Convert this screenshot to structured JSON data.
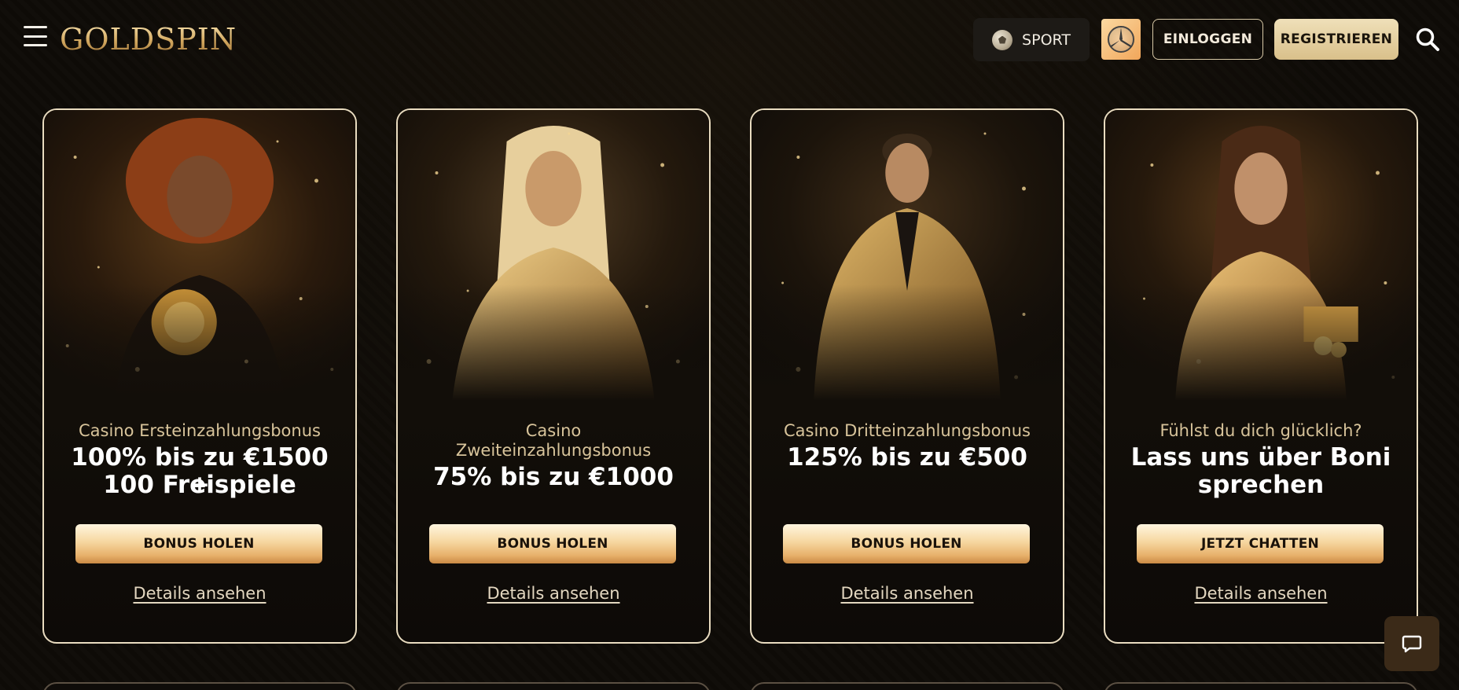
{
  "header": {
    "brand": "GOLDSPIN",
    "sport_label": "SPORT",
    "login_label": "EINLOGGEN",
    "register_label": "REGISTRIEREN",
    "icons": {
      "menu": "hamburger-menu-icon",
      "sport": "soccer-ball-icon",
      "partner": "mercedes-star-logo",
      "search": "search-icon"
    }
  },
  "cards": [
    {
      "subtitle": "Casino Ersteinzahlungsbonus",
      "headline_line1": "100% bis zu €1500 +",
      "headline_line2": "100 Freispiele",
      "button_label": "BONUS HOLEN",
      "link_label": "Details ansehen"
    },
    {
      "subtitle_line1": "Casino",
      "subtitle_line2": "Zweiteinzahlungsbonus",
      "headline_line1": "75% bis zu €1000",
      "button_label": "BONUS HOLEN",
      "link_label": "Details ansehen"
    },
    {
      "subtitle": "Casino Dritteinzahlungsbonus",
      "headline_line1": "125% bis zu €500",
      "button_label": "BONUS HOLEN",
      "link_label": "Details ansehen"
    },
    {
      "subtitle": "Fühlst du dich glücklich?",
      "headline_line1": "Lass uns über Boni",
      "headline_line2": "sprechen",
      "button_label": "JETZT CHATTEN",
      "link_label": "Details ansehen"
    }
  ],
  "chat": {
    "icon": "chat-bubble-icon"
  },
  "colors": {
    "background": "#0e0b07",
    "gold": "#d8c49b",
    "button_gold": "#f6d7a0",
    "card_border": "#e9dcc0"
  }
}
